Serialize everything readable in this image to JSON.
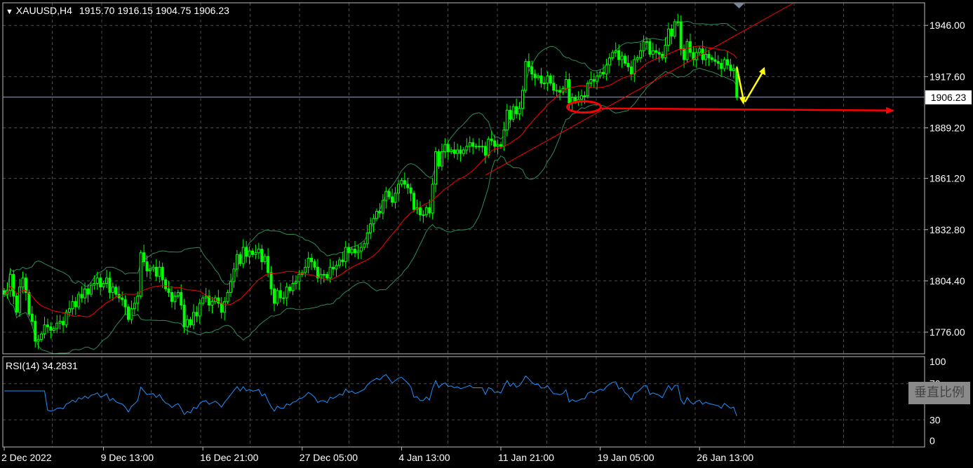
{
  "header": {
    "symbol": "XAUUSD,H4",
    "open": "1915.70",
    "high": "1916.15",
    "low": "1904.75",
    "close": "1906.23"
  },
  "rsi_label": "RSI(14) 34.2831",
  "scale_button": "垂直比例",
  "current_price": "1906.23",
  "colors": {
    "candle": "#00ff00",
    "ma": "#ff0000",
    "bollinger": "#2e8b57",
    "rsi": "#1e90ff",
    "trend_line": "#ff0000",
    "annotation_arrow": "#ffff00",
    "grid": "#4a4a4a",
    "background": "#000000"
  },
  "chart_data": [
    {
      "type": "candlestick",
      "title": "XAUUSD,H4",
      "y_ticks": [
        1776.0,
        1804.4,
        1832.8,
        1861.2,
        1889.2,
        1917.6,
        1946.0
      ],
      "y_tick_labels": [
        "1776.00",
        "1804.40",
        "1832.80",
        "1861.20",
        "1889.20",
        "1917.60",
        "1946.00"
      ],
      "ylim": [
        1764.0,
        1958.5
      ],
      "x_tick_labels": [
        "2 Dec 2022",
        "9 Dec 13:00",
        "16 Dec 21:00",
        "27 Dec 05:00",
        "4 Jan 13:00",
        "11 Jan 21:00",
        "19 Jan 05:00",
        "26 Jan 13:00"
      ],
      "x_tick_index": [
        0,
        32,
        64,
        96,
        128,
        160,
        192,
        224
      ],
      "grid": true,
      "horizontal_line": 1906.23,
      "series": [
        {
          "close": [
            1797,
            1799,
            1808,
            1796,
            1787,
            1801,
            1806,
            1798,
            1786,
            1782,
            1771,
            1772,
            1775,
            1780,
            1779,
            1777,
            1778,
            1781,
            1782,
            1780,
            1787,
            1789,
            1793,
            1790,
            1797,
            1795,
            1800,
            1797,
            1802,
            1803,
            1806,
            1801,
            1803,
            1806,
            1798,
            1801,
            1797,
            1795,
            1794,
            1790,
            1783,
            1789,
            1792,
            1796,
            1820,
            1815,
            1810,
            1811,
            1812,
            1807,
            1812,
            1805,
            1800,
            1798,
            1793,
            1796,
            1798,
            1791,
            1779,
            1783,
            1780,
            1787,
            1785,
            1792,
            1795,
            1796,
            1791,
            1793,
            1795,
            1792,
            1787,
            1793,
            1798,
            1804,
            1811,
            1819,
            1814,
            1823,
            1818,
            1821,
            1819,
            1820,
            1822,
            1815,
            1818,
            1809,
            1800,
            1792,
            1799,
            1795,
            1795,
            1801,
            1799,
            1803,
            1804,
            1808,
            1809,
            1812,
            1817,
            1815,
            1812,
            1806,
            1808,
            1808,
            1806,
            1812,
            1811,
            1813,
            1816,
            1815,
            1823,
            1820,
            1822,
            1820,
            1821,
            1823,
            1825,
            1831,
            1836,
            1839,
            1843,
            1842,
            1849,
            1854,
            1851,
            1848,
            1853,
            1858,
            1860,
            1858,
            1856,
            1853,
            1844,
            1845,
            1841,
            1841,
            1845,
            1842,
            1858,
            1876,
            1868,
            1876,
            1880,
            1876,
            1877,
            1875,
            1877,
            1875,
            1877,
            1879,
            1881,
            1879,
            1879,
            1879,
            1879,
            1874,
            1883,
            1882,
            1879,
            1880,
            1879,
            1888,
            1899,
            1894,
            1901,
            1897,
            1900,
            1910,
            1926,
            1923,
            1919,
            1917,
            1918,
            1914,
            1914,
            1918,
            1914,
            1910,
            1910,
            1909,
            1911,
            1916,
            1903,
            1906,
            1904,
            1905,
            1907,
            1907,
            1914,
            1916,
            1915,
            1918,
            1920,
            1919,
            1924,
            1928,
            1931,
            1932,
            1927,
            1929,
            1925,
            1923,
            1919,
            1927,
            1928,
            1932,
            1937,
            1937,
            1930,
            1932,
            1931,
            1930,
            1928,
            1935,
            1944,
            1940,
            1948,
            1948,
            1933,
            1927,
            1937,
            1931,
            1927,
            1931,
            1933,
            1927,
            1930,
            1928,
            1927,
            1926,
            1925,
            1922,
            1927,
            1924,
            1921,
            1922,
            1906
          ]
        },
        {
          "name": "",
          "ma": true
        },
        {
          "name": "",
          "bollinger": true
        }
      ]
    },
    {
      "type": "line",
      "title": "RSI(14) 34.2831",
      "y_ticks": [
        0,
        30,
        70,
        100
      ],
      "y_tick_labels": [
        "0",
        "30",
        "70",
        "100"
      ],
      "ylim": [
        0,
        100
      ],
      "last_value": 34.2831
    }
  ]
}
